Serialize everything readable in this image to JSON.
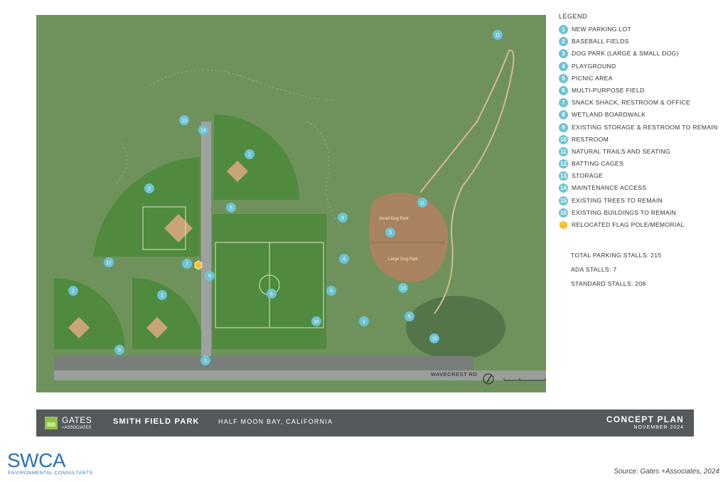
{
  "legend": {
    "title": "LEGEND",
    "items": [
      {
        "num": "1",
        "label": "NEW PARKING LOT"
      },
      {
        "num": "2",
        "label": "BASEBALL FIELDS"
      },
      {
        "num": "3",
        "label": "DOG PARK (LARGE & SMALL DOG)"
      },
      {
        "num": "4",
        "label": "PLAYGROUND"
      },
      {
        "num": "5",
        "label": "PICNIC AREA"
      },
      {
        "num": "6",
        "label": "MULTI-PURPOSE FIELD"
      },
      {
        "num": "7",
        "label": "SNACK SHACK, RESTROOM & OFFICE"
      },
      {
        "num": "8",
        "label": "WETLAND BOARDWALK"
      },
      {
        "num": "9",
        "label": "EXISTING STORAGE & RESTROOM TO REMAIN"
      },
      {
        "num": "10",
        "label": "RESTROOM"
      },
      {
        "num": "11",
        "label": "NATURAL TRAILS AND SEATING"
      },
      {
        "num": "12",
        "label": "BATTING CAGES"
      },
      {
        "num": "13",
        "label": "STORAGE"
      },
      {
        "num": "14",
        "label": "MAINTENANCE ACCESS"
      },
      {
        "num": "15",
        "label": "EXISTING TREES TO REMAIN"
      },
      {
        "num": "16",
        "label": "EXISTING BUILDINGS TO REMAIN"
      },
      {
        "num": "",
        "label": "RELOCATED FLAG POLE/MEMORIAL"
      }
    ]
  },
  "stats": {
    "total": "TOTAL PARKING STALLS: 215",
    "ada": "ADA STALLS: 7",
    "standard": "STANDARD STALLS: 208"
  },
  "map": {
    "road_label": "WAVECREST RD",
    "small_dog_park": "Small Dog Park",
    "large_dog_park": "Large Dog Park",
    "markers": [
      {
        "num": "11"
      },
      {
        "num": "13"
      },
      {
        "num": "14"
      },
      {
        "num": "2"
      },
      {
        "num": "2"
      },
      {
        "num": "5"
      },
      {
        "num": "8"
      },
      {
        "num": "11"
      },
      {
        "num": "3"
      },
      {
        "num": "12"
      },
      {
        "num": "7"
      },
      {
        "num": "5"
      },
      {
        "num": "4"
      },
      {
        "num": "5"
      },
      {
        "num": "15"
      },
      {
        "num": "2"
      },
      {
        "num": "2"
      },
      {
        "num": "6"
      },
      {
        "num": "10"
      },
      {
        "num": "1"
      },
      {
        "num": "5"
      },
      {
        "num": "15"
      },
      {
        "num": "9"
      },
      {
        "num": "1"
      }
    ]
  },
  "titlebar": {
    "firm": "GATES",
    "firm_sub": "+ASSOCIATES",
    "project": "SMITH FIELD PARK",
    "location": "HALF MOON BAY, CALIFORNIA",
    "plan": "CONCEPT PLAN",
    "date": "NOVEMBER 2024"
  },
  "footer": {
    "swca": "SWCA",
    "swca_sub": "ENVIRONMENTAL CONSULTANTS",
    "source": "Source: Gates +Associates, 2024"
  },
  "colors": {
    "grass": "#6b8f58",
    "field": "#4f8a3e",
    "infield": "#c9a47a",
    "dog_park": "#a9835f",
    "marker": "#6cc4d4",
    "titlebar": "#55595c",
    "brand": "#2b71b3"
  }
}
